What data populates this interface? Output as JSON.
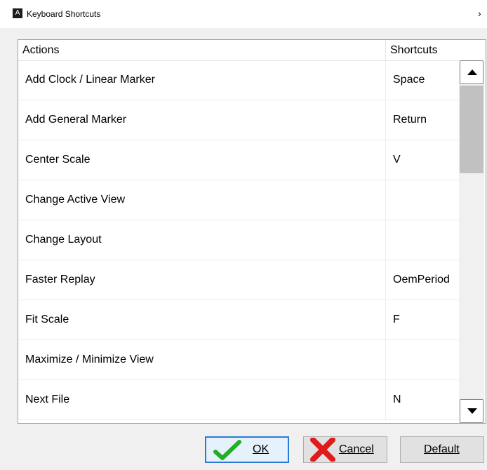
{
  "window": {
    "title": "Keyboard Shortcuts",
    "app_icon_letter": "A",
    "close_glyph": "›"
  },
  "table": {
    "columns": [
      "Actions",
      "Shortcuts"
    ],
    "rows": [
      {
        "action": "Add Clock / Linear Marker",
        "shortcut": "Space"
      },
      {
        "action": "Add General Marker",
        "shortcut": "Return"
      },
      {
        "action": "Center Scale",
        "shortcut": "V"
      },
      {
        "action": "Change Active View",
        "shortcut": ""
      },
      {
        "action": "Change Layout",
        "shortcut": ""
      },
      {
        "action": "Faster Replay",
        "shortcut": "OemPeriod"
      },
      {
        "action": "Fit Scale",
        "shortcut": "F"
      },
      {
        "action": "Maximize / Minimize View",
        "shortcut": ""
      },
      {
        "action": "Next File",
        "shortcut": "N"
      }
    ],
    "scroll_position": 0.0
  },
  "buttons": {
    "ok": "OK",
    "cancel": "Cancel",
    "default": "Default"
  },
  "icons": {
    "ok": "check-icon",
    "cancel": "x-icon",
    "scroll_up": "triangle-up-icon",
    "scroll_down": "triangle-down-icon"
  },
  "colors": {
    "check": "#22b022",
    "cross": "#e01b1b",
    "focus_border": "#2b7bd1"
  }
}
